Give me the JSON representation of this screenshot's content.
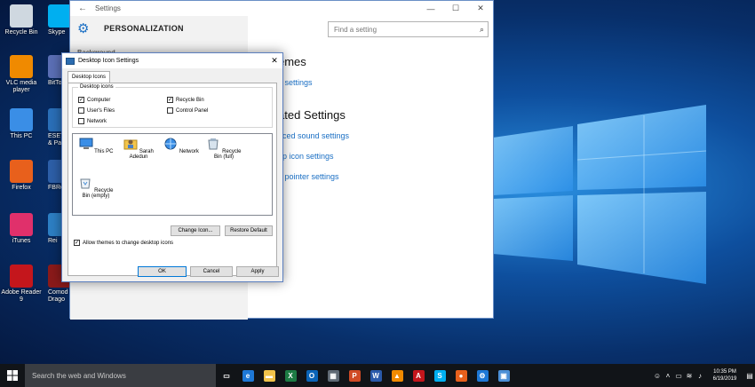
{
  "desktop": {
    "icons": [
      {
        "label": "Recycle Bin",
        "icon": "recycle-bin-icon",
        "color": "#cfd8e0"
      },
      {
        "label": "VLC media player",
        "icon": "vlc-icon",
        "color": "#f08a00"
      },
      {
        "label": "This PC",
        "icon": "computer-icon",
        "color": "#3a8ee6"
      },
      {
        "label": "Firefox",
        "icon": "firefox-icon",
        "color": "#e8601c"
      },
      {
        "label": "iTunes",
        "icon": "itunes-icon",
        "color": "#e0306b"
      },
      {
        "label": "Adobe Reader 9",
        "icon": "adobe-reader-icon",
        "color": "#c4161c"
      }
    ],
    "icons2": [
      {
        "label": "Skype",
        "icon": "skype-icon",
        "color": "#00aff0"
      },
      {
        "label": "BitTo",
        "icon": "bittorrent-icon",
        "color": "#5b6fb5"
      },
      {
        "label": "ESET I & Pay",
        "icon": "eset-icon",
        "color": "#2a6fb8"
      },
      {
        "label": "FBRe",
        "icon": "fbreader-icon",
        "color": "#2d5fa8"
      },
      {
        "label": "Rei",
        "icon": "reimage-icon",
        "color": "#2d7fc4"
      },
      {
        "label": "Comod Drago",
        "icon": "comodo-dragon-icon",
        "color": "#8a1a1a"
      }
    ]
  },
  "settings": {
    "window_title": "Settings",
    "page_title": "PERSONALIZATION",
    "nav_item": "Background",
    "search_placeholder": "Find a setting",
    "content": {
      "h1": "emes",
      "link1": "e settings",
      "h2": "ated Settings",
      "link2": "nced sound settings",
      "link3": "op icon settings",
      "link4": "e pointer settings"
    }
  },
  "dialog": {
    "title": "Desktop Icon Settings",
    "tab": "Desktop Icons",
    "group_label": "Desktop icons",
    "checkboxes": [
      {
        "label": "Computer",
        "checked": true
      },
      {
        "label": "Recycle Bin",
        "checked": true
      },
      {
        "label": "User's Files",
        "checked": false
      },
      {
        "label": "Control Panel",
        "checked": false
      },
      {
        "label": "Network",
        "checked": false
      }
    ],
    "items": [
      {
        "label": "This PC",
        "icon": "monitor-icon"
      },
      {
        "label": "Sarah Adedun",
        "icon": "user-folder-icon"
      },
      {
        "label": "Network",
        "icon": "network-icon"
      },
      {
        "label": "Recycle Bin (full)",
        "icon": "recycle-bin-full-icon"
      },
      {
        "label": "Recycle Bin (empty)",
        "icon": "recycle-bin-empty-icon"
      }
    ],
    "change_icon": "Change Icon...",
    "restore_default": "Restore Default",
    "allow_themes": "Allow themes to change desktop icons",
    "allow_themes_checked": true,
    "ok": "OK",
    "cancel": "Cancel",
    "apply": "Apply"
  },
  "taskbar": {
    "search_placeholder": "Search the web and Windows",
    "apps": [
      {
        "name": "task-view-icon",
        "glyph": "▭",
        "color": "#111418"
      },
      {
        "name": "edge-icon",
        "glyph": "e",
        "color": "#1e78d6"
      },
      {
        "name": "file-explorer-icon",
        "glyph": "▬",
        "color": "#f0c24a"
      },
      {
        "name": "excel-icon",
        "glyph": "X",
        "color": "#1d7b44"
      },
      {
        "name": "outlook-icon",
        "glyph": "O",
        "color": "#0a64b8"
      },
      {
        "name": "store-icon",
        "glyph": "▦",
        "color": "#606a75"
      },
      {
        "name": "powerpoint-icon",
        "glyph": "P",
        "color": "#d04a25"
      },
      {
        "name": "word-icon",
        "glyph": "W",
        "color": "#2a5aab"
      },
      {
        "name": "vlc-icon",
        "glyph": "▲",
        "color": "#f08a00"
      },
      {
        "name": "acrobat-icon",
        "glyph": "A",
        "color": "#c4161c"
      },
      {
        "name": "skype-icon",
        "glyph": "S",
        "color": "#00aff0"
      },
      {
        "name": "firefox-icon",
        "glyph": "●",
        "color": "#e8601c"
      },
      {
        "name": "settings-icon",
        "glyph": "⚙",
        "color": "#1e78d6"
      },
      {
        "name": "desktop-icon-settings-icon",
        "glyph": "▣",
        "color": "#4b8fd6"
      }
    ],
    "time": "10:35 PM",
    "date": "6/19/2019"
  }
}
